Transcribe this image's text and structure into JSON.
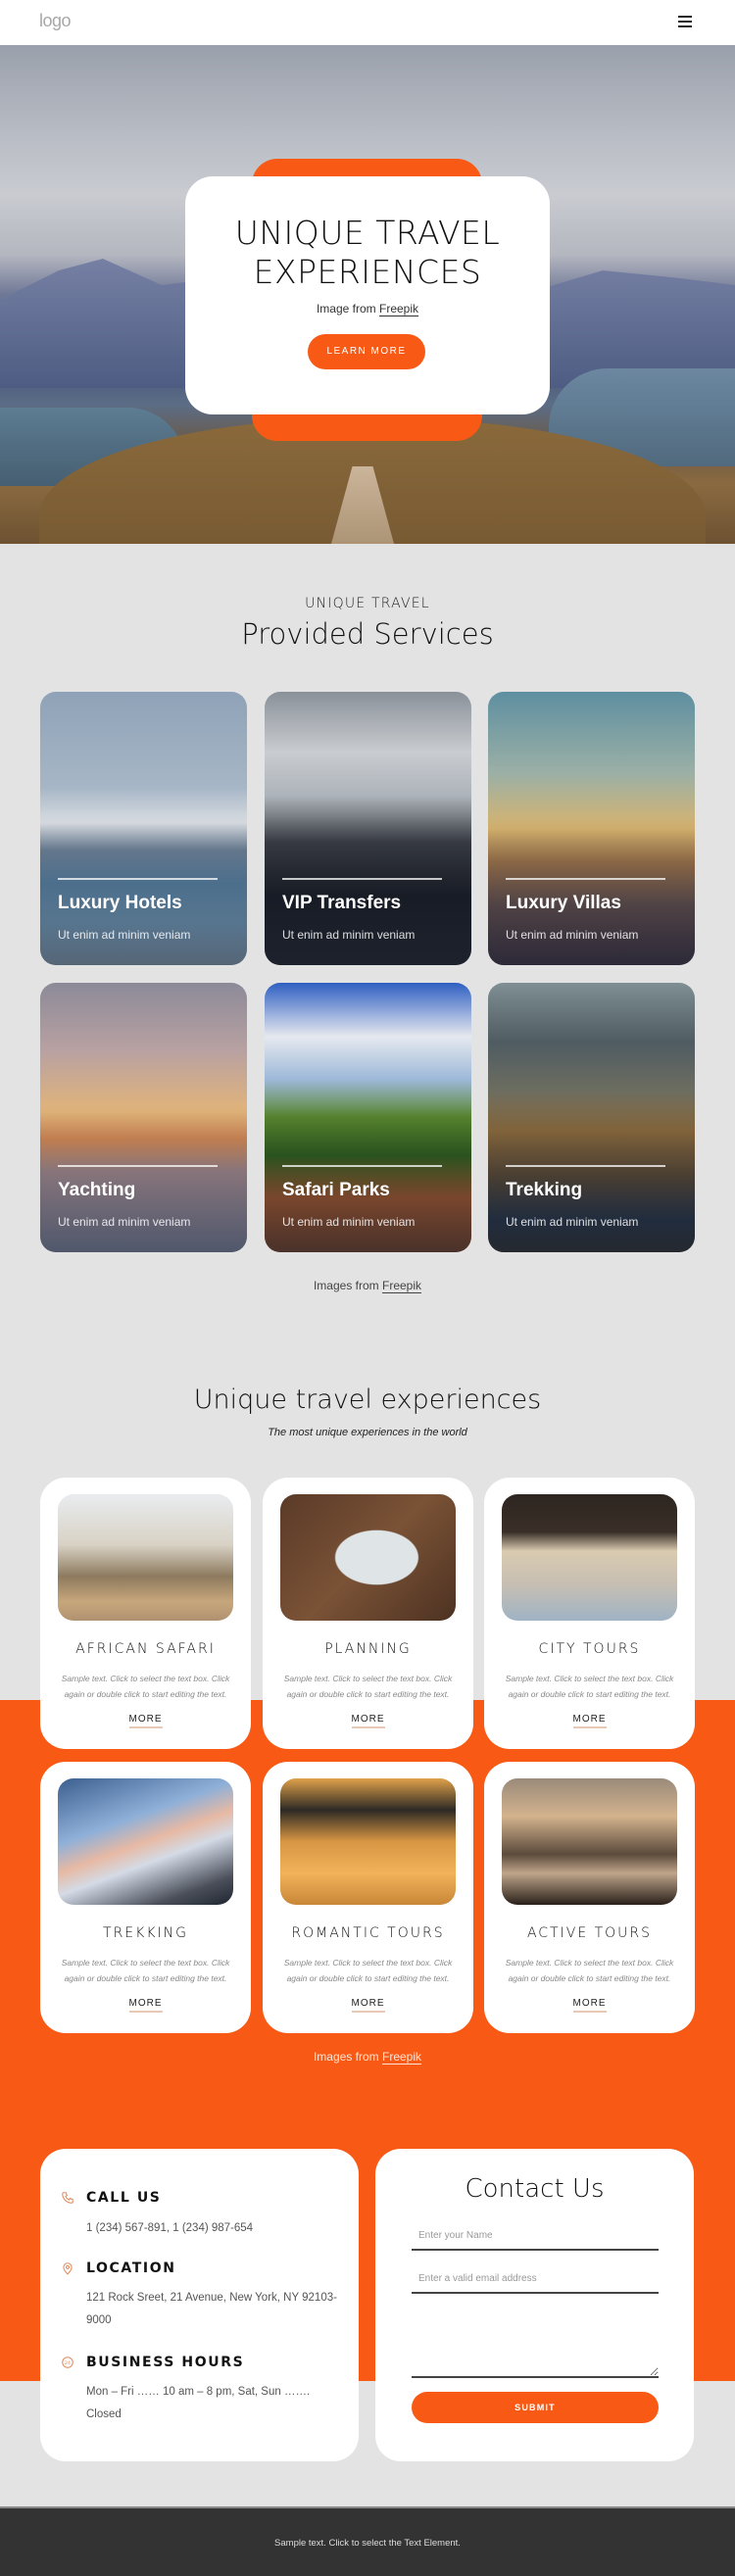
{
  "header": {
    "logo": "logo",
    "menu_icon": "hamburger-icon"
  },
  "hero": {
    "title": "UNIQUE TRAVEL EXPERIENCES",
    "credit_prefix": "Image from ",
    "credit_link": "Freepik",
    "cta": "LEARN MORE"
  },
  "services": {
    "kicker": "UNIQUE TRAVEL",
    "title": "Provided Services",
    "items": [
      {
        "name": "Luxury Hotels",
        "desc": "Ut enim ad minim veniam"
      },
      {
        "name": "VIP Transfers",
        "desc": "Ut enim ad minim veniam"
      },
      {
        "name": "Luxury Villas",
        "desc": "Ut enim ad minim veniam"
      },
      {
        "name": "Yachting",
        "desc": "Ut enim ad minim veniam"
      },
      {
        "name": "Safari Parks",
        "desc": "Ut enim ad minim veniam"
      },
      {
        "name": "Trekking",
        "desc": "Ut enim ad minim veniam"
      }
    ],
    "credit_prefix": "Images from ",
    "credit_link": "Freepik"
  },
  "experiences": {
    "title": "Unique travel experiences",
    "subtitle": "The most unique experiences in the world",
    "items": [
      {
        "title": "AFRICAN SAFARI",
        "text": "Sample text. Click to select the text box. Click again or double click to start editing the text.",
        "more": "MORE"
      },
      {
        "title": "PLANNING",
        "text": "Sample text. Click to select the text box. Click again or double click to start editing the text.",
        "more": "MORE"
      },
      {
        "title": "CITY TOURS",
        "text": "Sample text. Click to select the text box. Click again or double click to start editing the text.",
        "more": "MORE"
      },
      {
        "title": "TREKKING",
        "text": "Sample text. Click to select the text box. Click again or double click to start editing the text.",
        "more": "MORE"
      },
      {
        "title": "ROMANTIC TOURS",
        "text": "Sample text. Click to select the text box. Click again or double click to start editing the text.",
        "more": "MORE"
      },
      {
        "title": "ACTIVE TOURS",
        "text": "Sample text. Click to select the text box. Click again or double click to start editing the text.",
        "more": "MORE"
      }
    ],
    "credit_prefix": "Images from ",
    "credit_link": "Freepik"
  },
  "contact_info": {
    "call": {
      "heading": "CALL US",
      "text": "1 (234) 567-891, 1 (234) 987-654",
      "icon": "phone-icon"
    },
    "location": {
      "heading": "LOCATION",
      "text": "121 Rock Sreet, 21 Avenue, New York, NY 92103-9000",
      "icon": "map-pin-icon"
    },
    "hours": {
      "heading": "BUSINESS HOURS",
      "text": "Mon – Fri …… 10 am – 8 pm, Sat, Sun ……. Closed",
      "icon": "clock-24-icon"
    }
  },
  "contact_form": {
    "title": "Contact Us",
    "name_placeholder": "Enter your Name",
    "name_value": "",
    "email_placeholder": "Enter a valid email address",
    "email_value": "",
    "message_placeholder": "",
    "message_value": "",
    "submit": "SUBMIT"
  },
  "footer": {
    "text": "Sample text. Click to select the Text Element."
  },
  "colors": {
    "accent": "#f85a15",
    "background": "#e3e3e3",
    "footer": "#333333"
  }
}
